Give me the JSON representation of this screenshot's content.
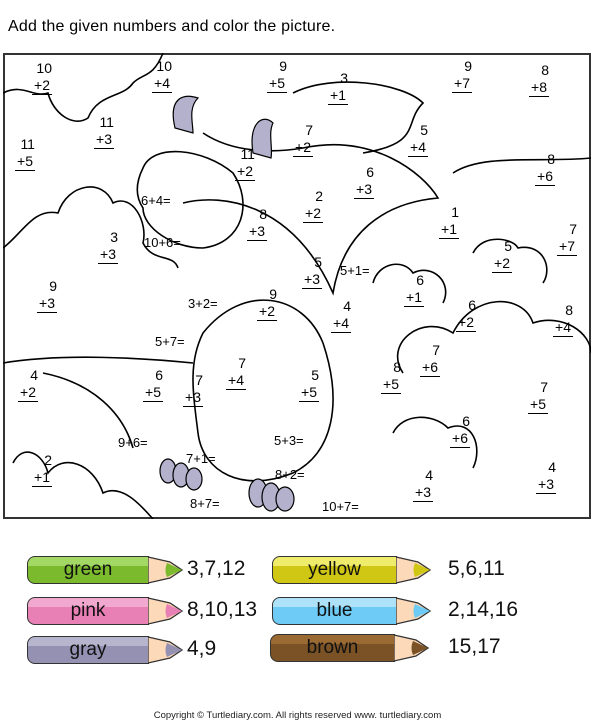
{
  "instruction": "Add the given numbers and color the picture.",
  "problems": [
    {
      "a": "10",
      "b": "+2"
    },
    {
      "a": "10",
      "b": "+4"
    },
    {
      "a": "9",
      "b": "+5"
    },
    {
      "a": "3",
      "b": "+1"
    },
    {
      "a": "9",
      "b": "+7"
    },
    {
      "a": "8",
      "b": "+8"
    },
    {
      "a": "11",
      "b": "+3"
    },
    {
      "a": "11",
      "b": "+5"
    },
    {
      "a": "7",
      "b": "+2"
    },
    {
      "a": "5",
      "b": "+4"
    },
    {
      "a": "11",
      "b": "+2"
    },
    {
      "a": "8",
      "b": "+6"
    },
    {
      "a": "6",
      "b": "+3"
    },
    {
      "a": "2",
      "b": "+2"
    },
    {
      "a": "1",
      "b": "+1"
    },
    {
      "a": "8",
      "b": "+3"
    },
    {
      "a": "3",
      "b": "+3"
    },
    {
      "a": "7",
      "b": "+7"
    },
    {
      "a": "5",
      "b": "+2"
    },
    {
      "a": "5",
      "b": "+3"
    },
    {
      "a": "9",
      "b": "+3"
    },
    {
      "a": "9",
      "b": "+2"
    },
    {
      "a": "6",
      "b": "+1"
    },
    {
      "a": "4",
      "b": "+4"
    },
    {
      "a": "6",
      "b": "+2"
    },
    {
      "a": "8",
      "b": "+4"
    },
    {
      "a": "7",
      "b": "+4"
    },
    {
      "a": "4",
      "b": "+2"
    },
    {
      "a": "6",
      "b": "+5"
    },
    {
      "a": "7",
      "b": "+3"
    },
    {
      "a": "7",
      "b": "+6"
    },
    {
      "a": "8",
      "b": "+5"
    },
    {
      "a": "5",
      "b": "+5"
    },
    {
      "a": "7",
      "b": "+5"
    },
    {
      "a": "6",
      "b": "+6"
    },
    {
      "a": "2",
      "b": "+1"
    },
    {
      "a": "4",
      "b": "+3"
    },
    {
      "a": "4",
      "b": "+3"
    }
  ],
  "equations": [
    "6+4=",
    "10+6=",
    "3+2=",
    "5+7=",
    "5+1=",
    "9+6=",
    "7+1=",
    "5+3=",
    "8+2=",
    "8+7=",
    "10+7="
  ],
  "pencils": [
    {
      "label": "green",
      "numbers": "3,7,12",
      "color": "#7aba2c",
      "light": "#a4d865"
    },
    {
      "label": "pink",
      "numbers": "8,10,13",
      "color": "#e87fb5",
      "light": "#f1a9cf"
    },
    {
      "label": "gray",
      "numbers": "4,9",
      "color": "#9491b3",
      "light": "#b7b5cd"
    },
    {
      "label": "yellow",
      "numbers": "5,6,11",
      "color": "#cfc713",
      "light": "#efec6c"
    },
    {
      "label": "blue",
      "numbers": "2,14,16",
      "color": "#6dcbf5",
      "light": "#aee2f9"
    },
    {
      "label": "brown",
      "numbers": "15,17",
      "color": "#7a5226",
      "light": "#9a6a32"
    }
  ],
  "prefilled_color": "#b3b1cc",
  "copyright": "Copyright © Turtlediary.com. All rights reserved   www. turtlediary.com"
}
